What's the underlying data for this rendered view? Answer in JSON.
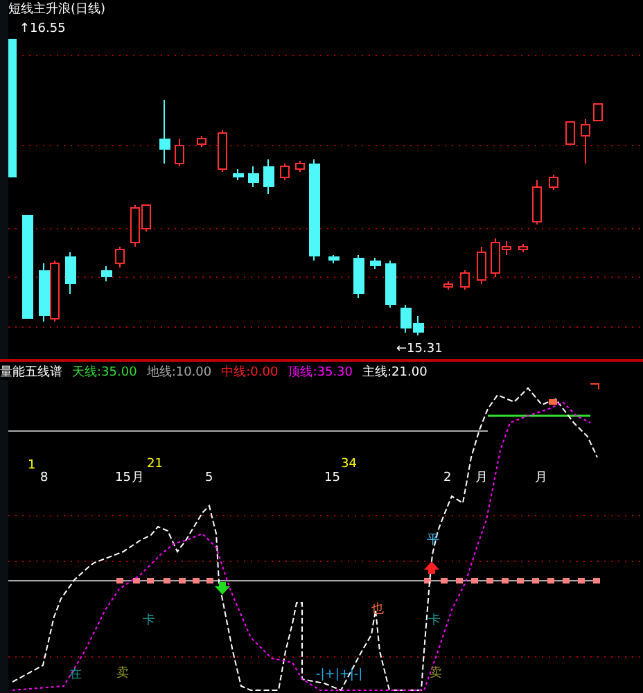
{
  "price_panel": {
    "title": "短线主升浪(日线)",
    "high_label": "↑16.55",
    "low_label": "←15.31"
  },
  "indicator": {
    "items": [
      {
        "text": "量能五线谱",
        "color": "#ffffff"
      },
      {
        "text": "天线:35.00",
        "color": "#33dd33"
      },
      {
        "text": "地线:10.00",
        "color": "#aaaaaa"
      },
      {
        "text": "中线:0.00",
        "color": "#ff2020"
      },
      {
        "text": "顶线:35.30",
        "color": "#ff00ff"
      },
      {
        "text": "主线:21.00",
        "color": "#ffffff"
      }
    ],
    "signals": [
      {
        "text": "1",
        "color": "#ffff00"
      },
      {
        "text": "8",
        "color": "#ffffff"
      },
      {
        "text": "15",
        "color": "#ffffff"
      },
      {
        "text": "月",
        "color": "#ffffff"
      },
      {
        "text": "21",
        "color": "#ffff00"
      },
      {
        "text": "5",
        "color": "#ffffff"
      },
      {
        "text": "15",
        "color": "#ffffff"
      },
      {
        "text": "34",
        "color": "#ffff00"
      },
      {
        "text": "2",
        "color": "#ffffff"
      },
      {
        "text": "月",
        "color": "#ffffff"
      },
      {
        "text": "月",
        "color": "#ffffff"
      },
      {
        "text": "平",
        "color": "#4fc3f7"
      },
      {
        "text": "卡",
        "color": "#1a9a9a"
      },
      {
        "text": "也",
        "color": "#ff6a40"
      },
      {
        "text": "卡",
        "color": "#1a9a9a"
      },
      {
        "text": "在",
        "color": "#1a9a9a"
      },
      {
        "text": "卖",
        "color": "#9a9a20"
      },
      {
        "text": "-|+|+|-|",
        "color": "#1ab0f0"
      },
      {
        "text": "卖",
        "color": "#9a9a20"
      }
    ]
  }
}
